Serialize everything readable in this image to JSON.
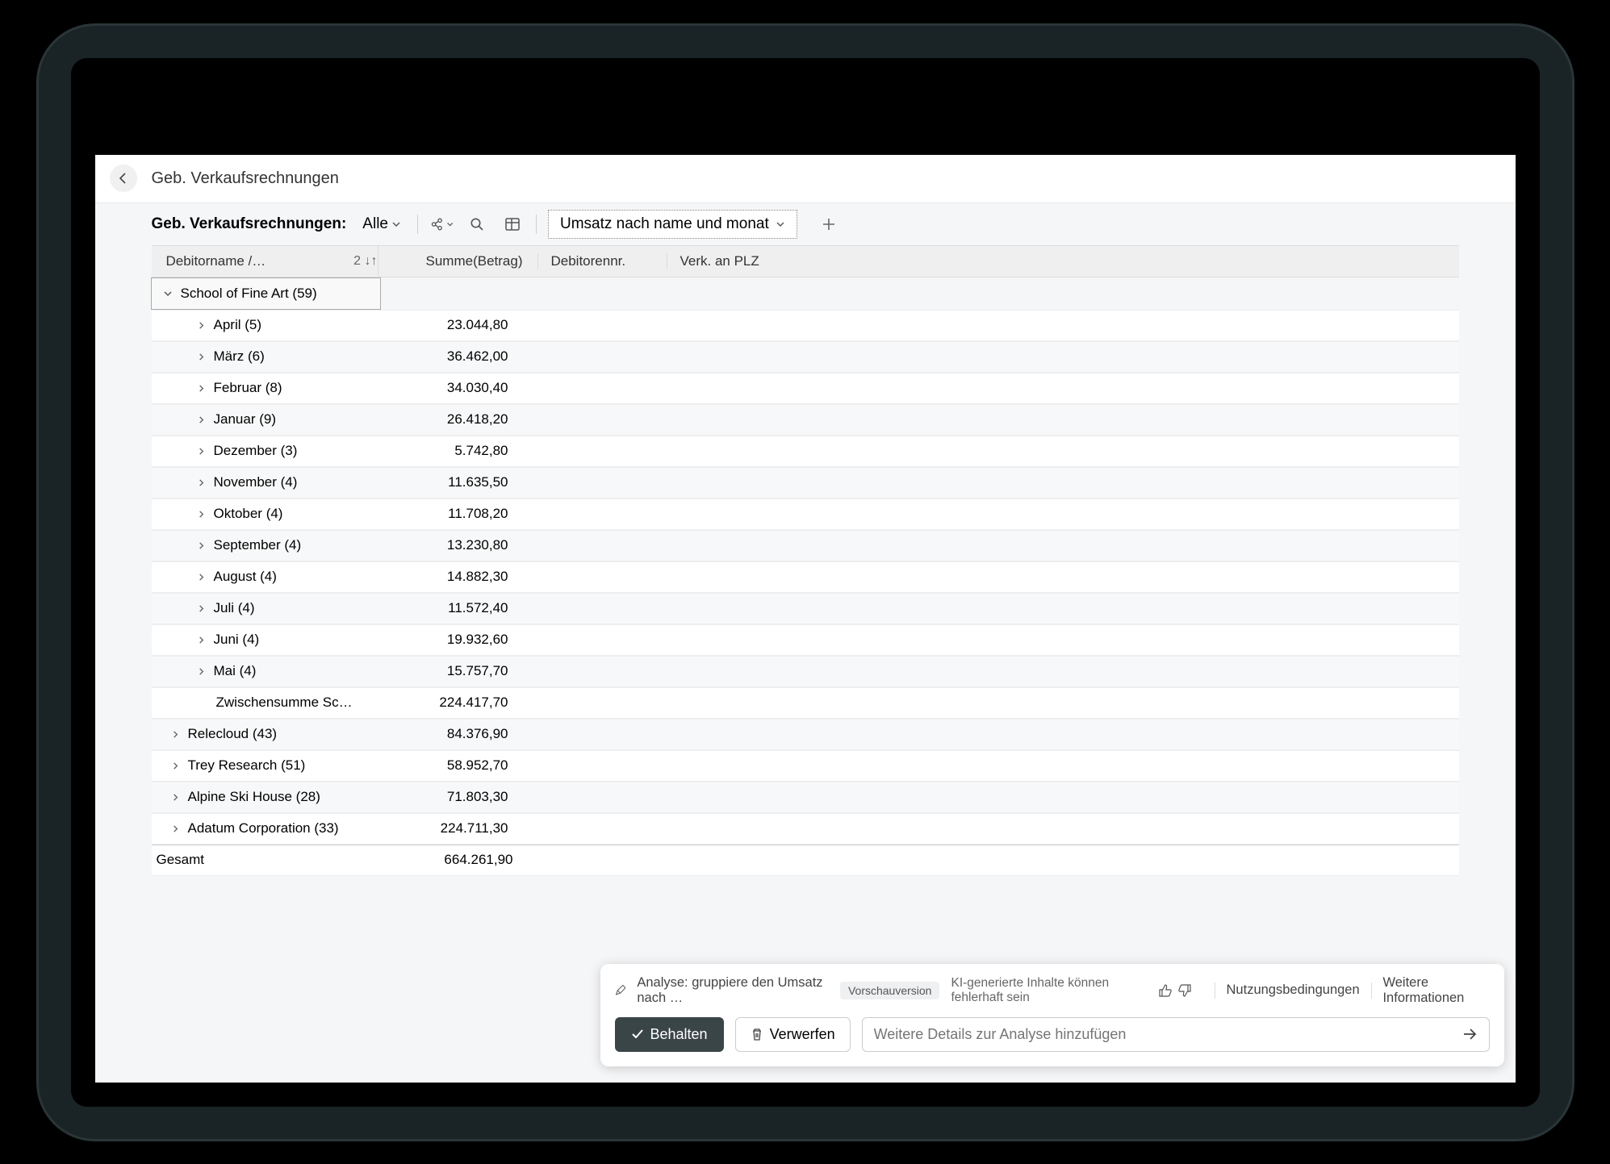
{
  "header": {
    "title": "Geb. Verkaufsrechnungen"
  },
  "toolbar": {
    "label": "Geb. Verkaufsrechnungen:",
    "filter": "Alle",
    "analysis_tab": "Umsatz nach name und monat"
  },
  "columns": {
    "name": "Debitorname /…",
    "sort_indicator": "2 ↓↑",
    "sum": "Summe(Betrag)",
    "debitor_no": "Debitorennr.",
    "plz": "Verk. an PLZ"
  },
  "group": {
    "label": "School of Fine Art (59)"
  },
  "months": [
    {
      "label": "April (5)",
      "sum": "23.044,80"
    },
    {
      "label": "März (6)",
      "sum": "36.462,00"
    },
    {
      "label": "Februar (8)",
      "sum": "34.030,40"
    },
    {
      "label": "Januar (9)",
      "sum": "26.418,20"
    },
    {
      "label": "Dezember (3)",
      "sum": "5.742,80"
    },
    {
      "label": "November (4)",
      "sum": "11.635,50"
    },
    {
      "label": "Oktober (4)",
      "sum": "11.708,20"
    },
    {
      "label": "September (4)",
      "sum": "13.230,80"
    },
    {
      "label": "August (4)",
      "sum": "14.882,30"
    },
    {
      "label": "Juli (4)",
      "sum": "11.572,40"
    },
    {
      "label": "Juni (4)",
      "sum": "19.932,60"
    },
    {
      "label": "Mai (4)",
      "sum": "15.757,70"
    }
  ],
  "subtotal": {
    "label": "Zwischensumme Sc…",
    "sum": "224.417,70"
  },
  "others": [
    {
      "label": "Relecloud (43)",
      "sum": "84.376,90"
    },
    {
      "label": "Trey Research (51)",
      "sum": "58.952,70"
    },
    {
      "label": "Alpine Ski House (28)",
      "sum": "71.803,30"
    },
    {
      "label": "Adatum Corporation (33)",
      "sum": "224.711,30"
    }
  ],
  "total": {
    "label": "Gesamt",
    "sum": "664.261,90"
  },
  "copilot": {
    "analysis_label": "Analyse: gruppiere den Umsatz nach …",
    "preview_badge": "Vorschauversion",
    "ai_note": "KI-generierte Inhalte können fehlerhaft sein",
    "terms": "Nutzungsbedingungen",
    "more_info": "Weitere Informationen",
    "keep": "Behalten",
    "discard": "Verwerfen",
    "prompt_placeholder": "Weitere Details zur Analyse hinzufügen"
  }
}
